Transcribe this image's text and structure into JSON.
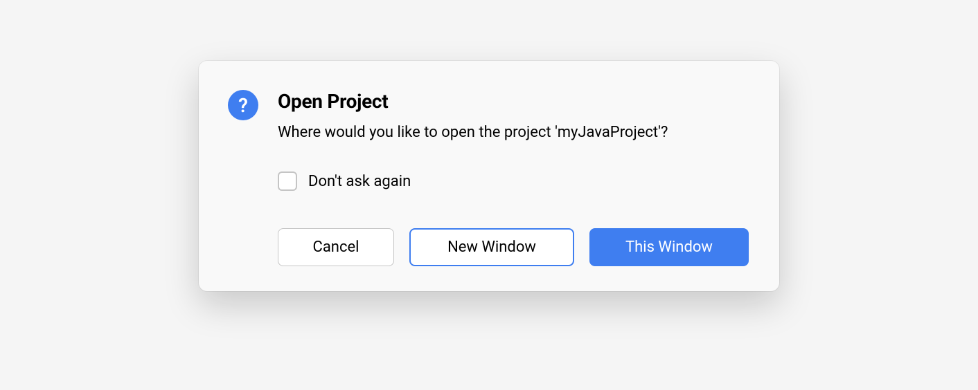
{
  "dialog": {
    "title": "Open Project",
    "message": "Where would you like to open the project 'myJavaProject'?",
    "checkbox_label": "Don't ask again",
    "buttons": {
      "cancel": "Cancel",
      "new_window": "New Window",
      "this_window": "This Window"
    },
    "icon": "question-mark",
    "colors": {
      "accent": "#3f7ef0"
    }
  }
}
